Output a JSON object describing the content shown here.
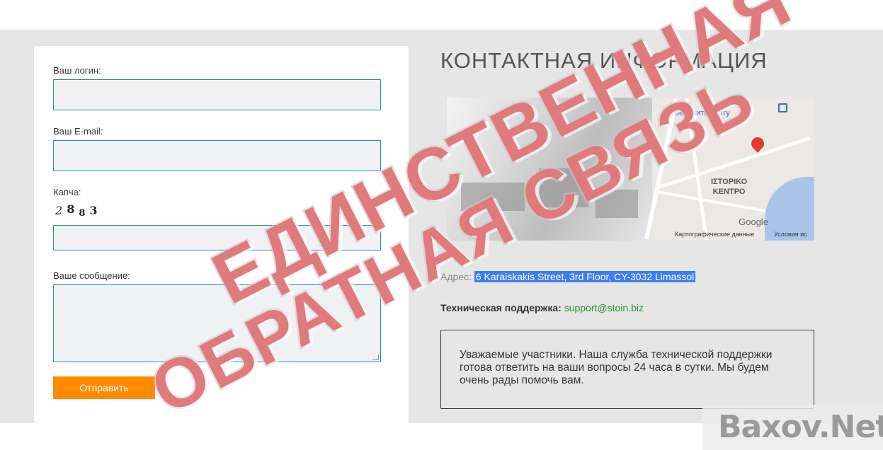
{
  "form": {
    "login_label": "Ваш логин:",
    "login_value": "",
    "email_label": "Ваш E-mail:",
    "email_value": "",
    "captcha_label": "Капча:",
    "captcha_chars": [
      "2",
      "8",
      "8",
      "3"
    ],
    "captcha_value": "",
    "message_label": "Ваше сообщение:",
    "message_value": "",
    "submit_label": "Отправить"
  },
  "contact": {
    "title": "КОНТАКТНАЯ ИНФОРМАЦИЯ",
    "map": {
      "enlarge_link": "Увеличить карту",
      "district_line1": "ΙΣΤΟΡΙΚΟ",
      "district_line2": "ΚΕΝΤΡΟ",
      "logo": "Google",
      "footer_data": "Картографические данные",
      "footer_terms": "Условия ис"
    },
    "address_label": "Адрес:",
    "address_value": "6 Karaiskakis Street, 3rd Floor, CY-3032 Limassol",
    "support_label": "Техническая поддержка:",
    "support_email": "support@stoin.biz",
    "notice_text": "Уважаемые участники. Наша служба технической поддержки готова ответить на ваши вопросы 24 часа в сутки. Мы будем очень рады помочь вам."
  },
  "stamp": {
    "line1": "ЕДИНСТВЕННАЯ",
    "line2": "ОБРАТНАЯ СВЯЗЬ"
  },
  "watermark": "Baxov.Net",
  "colors": {
    "accent_button": "#ff8a00",
    "field_border": "#2a86b8",
    "stamp_red": "#d6464a",
    "support_link": "#2e8b2e",
    "selection": "#3d7ef0"
  }
}
